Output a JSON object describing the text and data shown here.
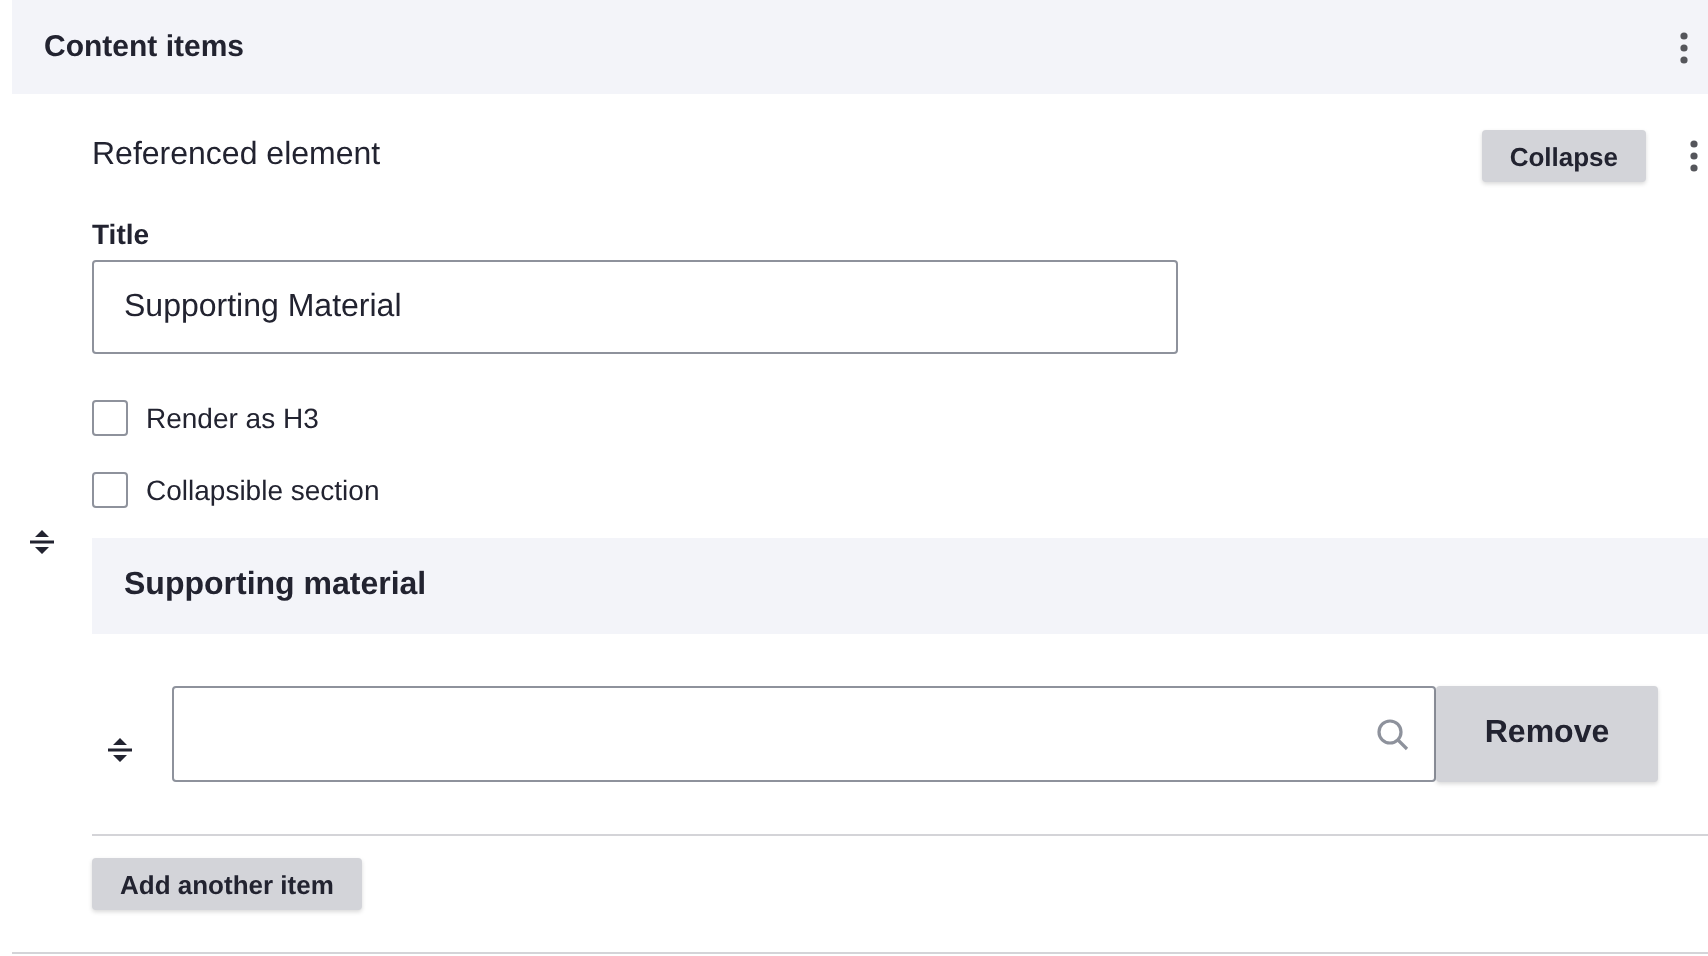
{
  "header": {
    "title": "Content items"
  },
  "element": {
    "label": "Referenced element",
    "collapse_button": "Collapse",
    "title_field": {
      "label": "Title",
      "value": "Supporting Material"
    },
    "checkboxes": [
      {
        "label": "Render as H3",
        "checked": false
      },
      {
        "label": "Collapsible section",
        "checked": false
      }
    ],
    "section": {
      "title": "Supporting material",
      "items": [
        {
          "remove_button": "Remove"
        }
      ],
      "add_button": "Add another item"
    }
  }
}
